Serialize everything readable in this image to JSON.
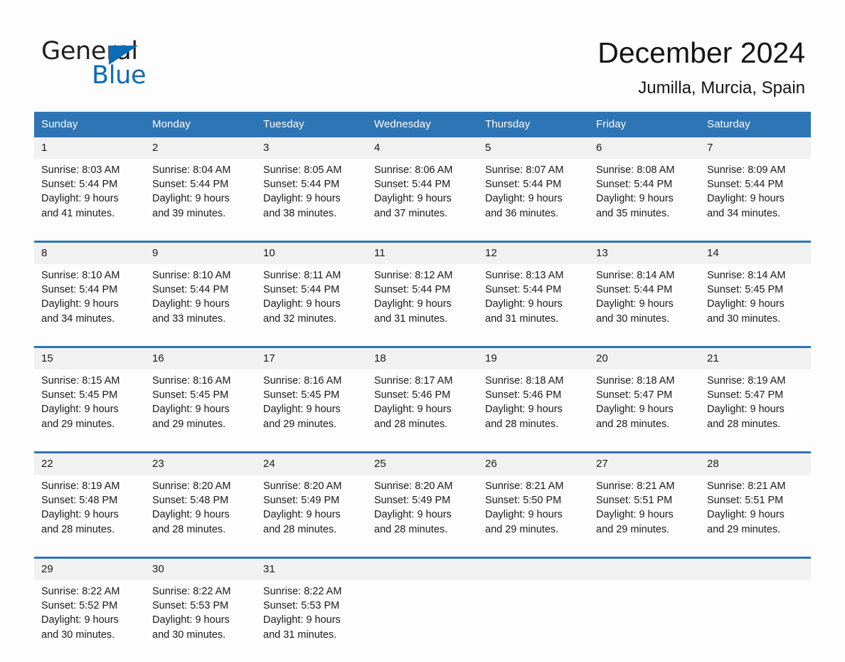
{
  "brand": {
    "name_part1": "General",
    "name_part2": "Blue",
    "triangle_color": "#0c6bb7",
    "logo_icon": "triangle-icon"
  },
  "header": {
    "title": "December 2024",
    "location": "Jumilla, Murcia, Spain"
  },
  "theme": {
    "header_blue": "#2e75b6",
    "daynum_band": "#f1f1f1",
    "page_bg": "#fdfdfd",
    "text": "#1a1a1a"
  },
  "calendar": {
    "weekday_headers": [
      "Sunday",
      "Monday",
      "Tuesday",
      "Wednesday",
      "Thursday",
      "Friday",
      "Saturday"
    ],
    "weeks": [
      [
        {
          "day": "1",
          "sunrise": "Sunrise: 8:03 AM",
          "sunset": "Sunset: 5:44 PM",
          "daylight_1": "Daylight: 9 hours",
          "daylight_2": "and 41 minutes."
        },
        {
          "day": "2",
          "sunrise": "Sunrise: 8:04 AM",
          "sunset": "Sunset: 5:44 PM",
          "daylight_1": "Daylight: 9 hours",
          "daylight_2": "and 39 minutes."
        },
        {
          "day": "3",
          "sunrise": "Sunrise: 8:05 AM",
          "sunset": "Sunset: 5:44 PM",
          "daylight_1": "Daylight: 9 hours",
          "daylight_2": "and 38 minutes."
        },
        {
          "day": "4",
          "sunrise": "Sunrise: 8:06 AM",
          "sunset": "Sunset: 5:44 PM",
          "daylight_1": "Daylight: 9 hours",
          "daylight_2": "and 37 minutes."
        },
        {
          "day": "5",
          "sunrise": "Sunrise: 8:07 AM",
          "sunset": "Sunset: 5:44 PM",
          "daylight_1": "Daylight: 9 hours",
          "daylight_2": "and 36 minutes."
        },
        {
          "day": "6",
          "sunrise": "Sunrise: 8:08 AM",
          "sunset": "Sunset: 5:44 PM",
          "daylight_1": "Daylight: 9 hours",
          "daylight_2": "and 35 minutes."
        },
        {
          "day": "7",
          "sunrise": "Sunrise: 8:09 AM",
          "sunset": "Sunset: 5:44 PM",
          "daylight_1": "Daylight: 9 hours",
          "daylight_2": "and 34 minutes."
        }
      ],
      [
        {
          "day": "8",
          "sunrise": "Sunrise: 8:10 AM",
          "sunset": "Sunset: 5:44 PM",
          "daylight_1": "Daylight: 9 hours",
          "daylight_2": "and 34 minutes."
        },
        {
          "day": "9",
          "sunrise": "Sunrise: 8:10 AM",
          "sunset": "Sunset: 5:44 PM",
          "daylight_1": "Daylight: 9 hours",
          "daylight_2": "and 33 minutes."
        },
        {
          "day": "10",
          "sunrise": "Sunrise: 8:11 AM",
          "sunset": "Sunset: 5:44 PM",
          "daylight_1": "Daylight: 9 hours",
          "daylight_2": "and 32 minutes."
        },
        {
          "day": "11",
          "sunrise": "Sunrise: 8:12 AM",
          "sunset": "Sunset: 5:44 PM",
          "daylight_1": "Daylight: 9 hours",
          "daylight_2": "and 31 minutes."
        },
        {
          "day": "12",
          "sunrise": "Sunrise: 8:13 AM",
          "sunset": "Sunset: 5:44 PM",
          "daylight_1": "Daylight: 9 hours",
          "daylight_2": "and 31 minutes."
        },
        {
          "day": "13",
          "sunrise": "Sunrise: 8:14 AM",
          "sunset": "Sunset: 5:44 PM",
          "daylight_1": "Daylight: 9 hours",
          "daylight_2": "and 30 minutes."
        },
        {
          "day": "14",
          "sunrise": "Sunrise: 8:14 AM",
          "sunset": "Sunset: 5:45 PM",
          "daylight_1": "Daylight: 9 hours",
          "daylight_2": "and 30 minutes."
        }
      ],
      [
        {
          "day": "15",
          "sunrise": "Sunrise: 8:15 AM",
          "sunset": "Sunset: 5:45 PM",
          "daylight_1": "Daylight: 9 hours",
          "daylight_2": "and 29 minutes."
        },
        {
          "day": "16",
          "sunrise": "Sunrise: 8:16 AM",
          "sunset": "Sunset: 5:45 PM",
          "daylight_1": "Daylight: 9 hours",
          "daylight_2": "and 29 minutes."
        },
        {
          "day": "17",
          "sunrise": "Sunrise: 8:16 AM",
          "sunset": "Sunset: 5:45 PM",
          "daylight_1": "Daylight: 9 hours",
          "daylight_2": "and 29 minutes."
        },
        {
          "day": "18",
          "sunrise": "Sunrise: 8:17 AM",
          "sunset": "Sunset: 5:46 PM",
          "daylight_1": "Daylight: 9 hours",
          "daylight_2": "and 28 minutes."
        },
        {
          "day": "19",
          "sunrise": "Sunrise: 8:18 AM",
          "sunset": "Sunset: 5:46 PM",
          "daylight_1": "Daylight: 9 hours",
          "daylight_2": "and 28 minutes."
        },
        {
          "day": "20",
          "sunrise": "Sunrise: 8:18 AM",
          "sunset": "Sunset: 5:47 PM",
          "daylight_1": "Daylight: 9 hours",
          "daylight_2": "and 28 minutes."
        },
        {
          "day": "21",
          "sunrise": "Sunrise: 8:19 AM",
          "sunset": "Sunset: 5:47 PM",
          "daylight_1": "Daylight: 9 hours",
          "daylight_2": "and 28 minutes."
        }
      ],
      [
        {
          "day": "22",
          "sunrise": "Sunrise: 8:19 AM",
          "sunset": "Sunset: 5:48 PM",
          "daylight_1": "Daylight: 9 hours",
          "daylight_2": "and 28 minutes."
        },
        {
          "day": "23",
          "sunrise": "Sunrise: 8:20 AM",
          "sunset": "Sunset: 5:48 PM",
          "daylight_1": "Daylight: 9 hours",
          "daylight_2": "and 28 minutes."
        },
        {
          "day": "24",
          "sunrise": "Sunrise: 8:20 AM",
          "sunset": "Sunset: 5:49 PM",
          "daylight_1": "Daylight: 9 hours",
          "daylight_2": "and 28 minutes."
        },
        {
          "day": "25",
          "sunrise": "Sunrise: 8:20 AM",
          "sunset": "Sunset: 5:49 PM",
          "daylight_1": "Daylight: 9 hours",
          "daylight_2": "and 28 minutes."
        },
        {
          "day": "26",
          "sunrise": "Sunrise: 8:21 AM",
          "sunset": "Sunset: 5:50 PM",
          "daylight_1": "Daylight: 9 hours",
          "daylight_2": "and 29 minutes."
        },
        {
          "day": "27",
          "sunrise": "Sunrise: 8:21 AM",
          "sunset": "Sunset: 5:51 PM",
          "daylight_1": "Daylight: 9 hours",
          "daylight_2": "and 29 minutes."
        },
        {
          "day": "28",
          "sunrise": "Sunrise: 8:21 AM",
          "sunset": "Sunset: 5:51 PM",
          "daylight_1": "Daylight: 9 hours",
          "daylight_2": "and 29 minutes."
        }
      ],
      [
        {
          "day": "29",
          "sunrise": "Sunrise: 8:22 AM",
          "sunset": "Sunset: 5:52 PM",
          "daylight_1": "Daylight: 9 hours",
          "daylight_2": "and 30 minutes."
        },
        {
          "day": "30",
          "sunrise": "Sunrise: 8:22 AM",
          "sunset": "Sunset: 5:53 PM",
          "daylight_1": "Daylight: 9 hours",
          "daylight_2": "and 30 minutes."
        },
        {
          "day": "31",
          "sunrise": "Sunrise: 8:22 AM",
          "sunset": "Sunset: 5:53 PM",
          "daylight_1": "Daylight: 9 hours",
          "daylight_2": "and 31 minutes."
        },
        {
          "day": "",
          "sunrise": "",
          "sunset": "",
          "daylight_1": "",
          "daylight_2": ""
        },
        {
          "day": "",
          "sunrise": "",
          "sunset": "",
          "daylight_1": "",
          "daylight_2": ""
        },
        {
          "day": "",
          "sunrise": "",
          "sunset": "",
          "daylight_1": "",
          "daylight_2": ""
        },
        {
          "day": "",
          "sunrise": "",
          "sunset": "",
          "daylight_1": "",
          "daylight_2": ""
        }
      ]
    ]
  }
}
